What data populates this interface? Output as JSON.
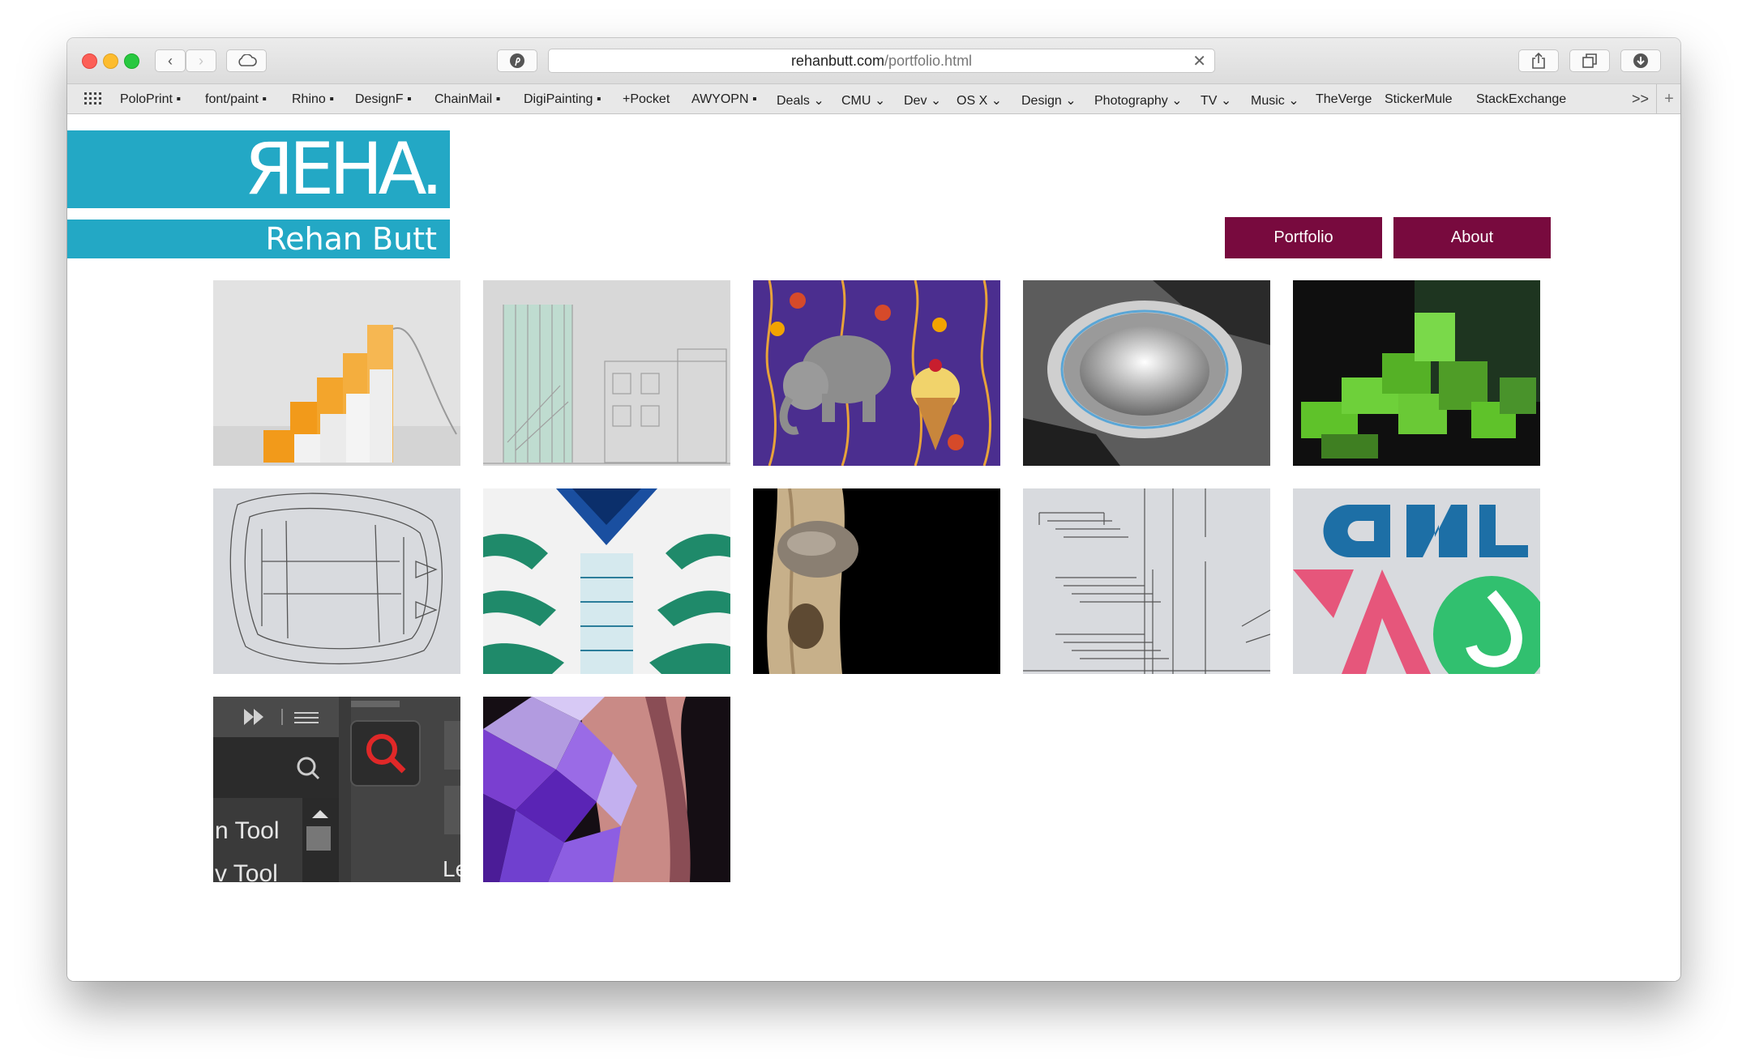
{
  "browser": {
    "url_domain": "rehanbutt.com",
    "url_path": "/portfolio.html",
    "bookmarks": [
      {
        "label": "PoloPrint ▪"
      },
      {
        "label": "font/paint ▪"
      },
      {
        "label": "Rhino ▪"
      },
      {
        "label": "DesignF ▪"
      },
      {
        "label": "ChainMail ▪"
      },
      {
        "label": "DigiPainting ▪"
      },
      {
        "label": "+Pocket"
      },
      {
        "label": "AWYOPN ▪"
      },
      {
        "label": "Deals ⌄"
      },
      {
        "label": "CMU ⌄"
      },
      {
        "label": "Dev ⌄"
      },
      {
        "label": "OS X ⌄"
      },
      {
        "label": "Design ⌄"
      },
      {
        "label": "Photography ⌄"
      },
      {
        "label": "TV ⌄"
      },
      {
        "label": "Music ⌄"
      },
      {
        "label": "TheVerge"
      },
      {
        "label": "StickerMule"
      },
      {
        "label": "StackExchange"
      }
    ],
    "overflow_label": ">>"
  },
  "site": {
    "logo_mark": "ЯEHA.",
    "logo_name": "Rehan Butt",
    "brand_color": "#23a8c5",
    "nav_color": "#780a3e",
    "nav": {
      "portfolio": "Portfolio",
      "about": "About"
    }
  },
  "tiles": [
    {
      "icon": "orange-stacked-blocks-render"
    },
    {
      "icon": "building-elevation-drawing"
    },
    {
      "icon": "elephant-pattern-illustration"
    },
    {
      "icon": "metal-ring-product-render"
    },
    {
      "icon": "green-blocks-render"
    },
    {
      "icon": "wireframe-chair-drawing"
    },
    {
      "icon": "architecture-atrium-render"
    },
    {
      "icon": "wood-stone-sculpture"
    },
    {
      "icon": "stair-construction-drawing"
    },
    {
      "icon": "geometric-logo-design"
    },
    {
      "icon": "software-ui-screenshot"
    },
    {
      "icon": "low-poly-figure-art"
    }
  ],
  "tile_texts": {
    "ui_tool_1": "n Tool",
    "ui_tool_2": "v Tool",
    "ui_tool_3": "Le"
  }
}
